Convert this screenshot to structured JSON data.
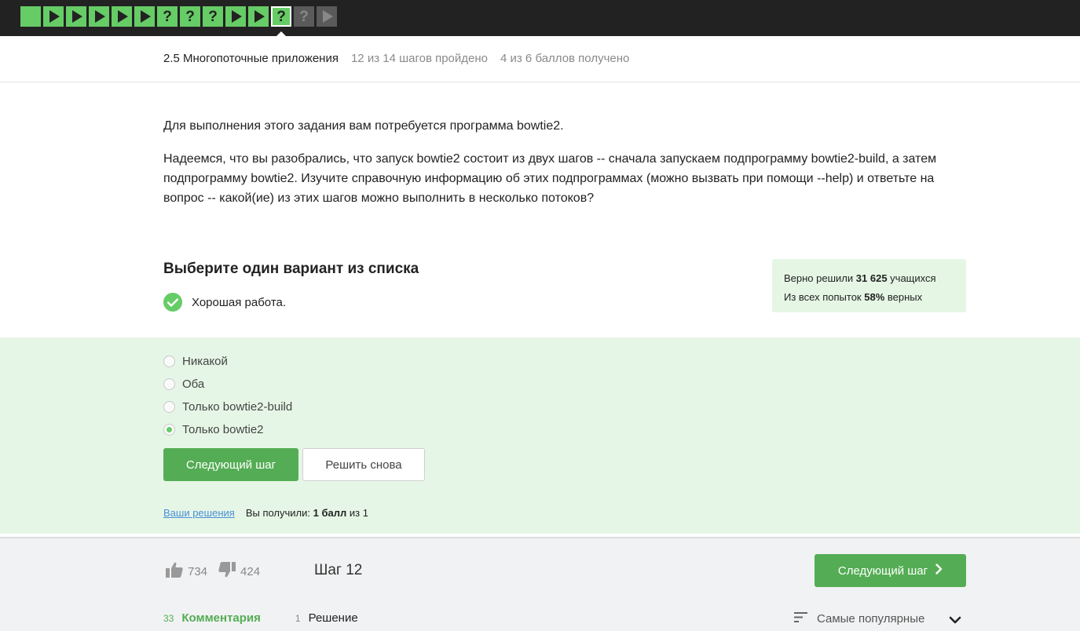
{
  "steps": [
    {
      "kind": "plain",
      "state": "done"
    },
    {
      "kind": "play",
      "state": "done"
    },
    {
      "kind": "play",
      "state": "done"
    },
    {
      "kind": "play",
      "state": "done"
    },
    {
      "kind": "play",
      "state": "done"
    },
    {
      "kind": "play",
      "state": "done"
    },
    {
      "kind": "quiz",
      "state": "done"
    },
    {
      "kind": "quiz",
      "state": "done"
    },
    {
      "kind": "quiz",
      "state": "done"
    },
    {
      "kind": "play",
      "state": "done"
    },
    {
      "kind": "play",
      "state": "done"
    },
    {
      "kind": "quiz",
      "state": "active"
    },
    {
      "kind": "quiz",
      "state": "todo"
    },
    {
      "kind": "play",
      "state": "todo"
    }
  ],
  "step_quiz_glyph": "?",
  "header": {
    "lesson": "2.5 Многопоточные приложения",
    "progress": "12 из 14 шагов пройдено",
    "score": "4 из 6 баллов  получено"
  },
  "content": {
    "p1": "Для выполнения этого задания вам потребуется программа bowtie2.",
    "p2": "Надеемся, что вы разобрались, что запуск bowtie2 состоит из двух шагов -- сначала запускаем подпрограмму bowtie2-build, а затем подпрограмму bowtie2. Изучите справочную информацию об этих подпрограммах (можно вызвать при помощи --help) и ответьте на вопрос -- какой(ие) из этих шагов можно выполнить в несколько потоков?"
  },
  "task": {
    "title": "Выберите один вариант из списка",
    "feedback": "Хорошая работа."
  },
  "stats": {
    "solved_prefix": "Верно решили",
    "solved_count": "31 625",
    "solved_suffix": "учащихся",
    "attempts_prefix": "Из всех попыток",
    "attempts_pct": "58%",
    "attempts_suffix": "верных"
  },
  "options": [
    {
      "label": "Никакой",
      "selected": false
    },
    {
      "label": "Оба",
      "selected": false
    },
    {
      "label": "Только bowtie2-build",
      "selected": false
    },
    {
      "label": "Только bowtie2",
      "selected": true
    }
  ],
  "buttons": {
    "next": "Следующий шаг",
    "retry": "Решить снова"
  },
  "solutions": {
    "link": "Ваши решения",
    "got_prefix": "Вы получили:",
    "got_value": "1 балл",
    "got_suffix": "из 1"
  },
  "footer": {
    "likes": "734",
    "dislikes": "424",
    "step_label": "Шаг 12",
    "next_label": "Следующий шаг",
    "comments_count": "33",
    "comments_label": "Комментария",
    "solutions_count": "1",
    "solutions_label": "Решение",
    "sort_label": "Самые популярные"
  },
  "colors": {
    "accent": "#54ad54",
    "step_done": "#66cc66",
    "link": "#4a8fd6"
  }
}
